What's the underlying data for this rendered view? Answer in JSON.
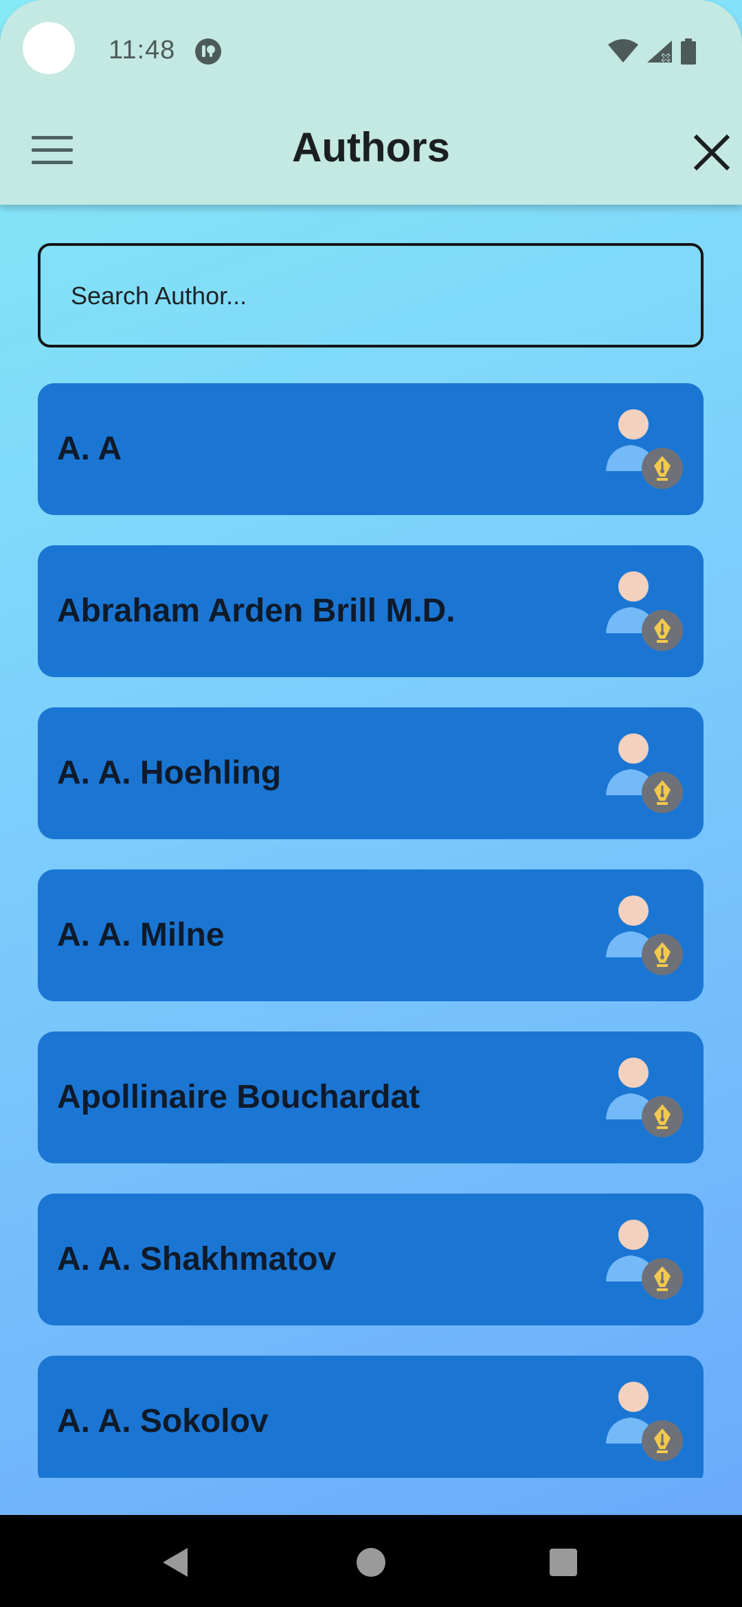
{
  "status_bar": {
    "time": "11:48",
    "app_icon": "pocket-app-icon",
    "icons": [
      "wifi-icon",
      "signal-no-service-icon",
      "battery-icon"
    ]
  },
  "app_bar": {
    "title": "Authors",
    "menu_icon": "hamburger-menu-icon",
    "close_icon": "close-icon"
  },
  "search": {
    "placeholder": "Search Author...",
    "value": ""
  },
  "authors": [
    {
      "name": "A. A",
      "icon": "author-avatar-pen-icon"
    },
    {
      "name": "Abraham Arden Brill M.D.",
      "icon": "author-avatar-pen-icon"
    },
    {
      "name": "A. A. Hoehling",
      "icon": "author-avatar-pen-icon"
    },
    {
      "name": "A. A. Milne",
      "icon": "author-avatar-pen-icon"
    },
    {
      "name": "Apollinaire Bouchardat",
      "icon": "author-avatar-pen-icon"
    },
    {
      "name": "A. A. Shakhmatov",
      "icon": "author-avatar-pen-icon"
    },
    {
      "name": "A. A. Sokolov",
      "icon": "author-avatar-pen-icon"
    }
  ],
  "nav_bar": {
    "buttons": [
      "back-icon",
      "home-icon",
      "recents-icon"
    ]
  },
  "colors": {
    "header_bg": "#c4e8e2",
    "card_bg": "#1b76d3",
    "gradient_top": "#86eaf6",
    "gradient_bottom": "#6aa8fb"
  }
}
